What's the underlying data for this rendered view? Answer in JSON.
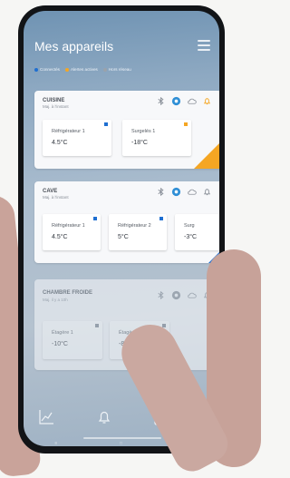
{
  "app": {
    "title": "Mes appareils"
  },
  "legend": [
    {
      "label": "Connectés",
      "color": "#1f6fd1"
    },
    {
      "label": "Alertes actives",
      "color": "#f5a623"
    },
    {
      "label": "Hors réseau",
      "color": "#9aa2ab"
    }
  ],
  "rooms": [
    {
      "name": "CUISINE",
      "subtitle": "Maj. à l'instant",
      "status_icons": [
        "bluetooth-icon",
        "gear-icon",
        "cloud-icon",
        "bell-icon"
      ],
      "alert_color": "#f5a623",
      "devices": [
        {
          "name": "Réfrigérateur 1",
          "value": "4.5°C",
          "flag_color": "#1f6fd1"
        },
        {
          "name": "Surgelés 1",
          "value": "-18°C",
          "flag_color": "#f5a623"
        }
      ]
    },
    {
      "name": "CAVE",
      "subtitle": "Maj. à l'instant",
      "status_icons": [
        "bluetooth-icon",
        "gear-icon",
        "cloud-icon",
        "bell-icon"
      ],
      "alert_color": "#1f6fd1",
      "devices": [
        {
          "name": "Réfrigérateur 1",
          "value": "4.5°C",
          "flag_color": "#1f6fd1"
        },
        {
          "name": "Réfrigérateur 2",
          "value": "5°C",
          "flag_color": "#1f6fd1"
        },
        {
          "name": "Surg",
          "value": "-3°C",
          "flag_color": "#1f6fd1"
        }
      ]
    },
    {
      "name": "CHAMBRE FROIDE",
      "subtitle": "Maj. il y a 10h",
      "status_icons": [
        "bluetooth-icon",
        "gear-icon",
        "cloud-icon",
        "bell-icon"
      ],
      "alert_color": "#9aa2ab",
      "devices": [
        {
          "name": "Étagère 1",
          "value": "-10°C",
          "flag_color": "#7d8590"
        },
        {
          "name": "Étagère 2",
          "value": "-8°C",
          "flag_color": "#7d8590"
        }
      ]
    }
  ],
  "bottom_nav": [
    "chart-icon",
    "bell-icon",
    "battery-icon"
  ],
  "system_nav": [
    "≡",
    "□",
    "◁"
  ]
}
